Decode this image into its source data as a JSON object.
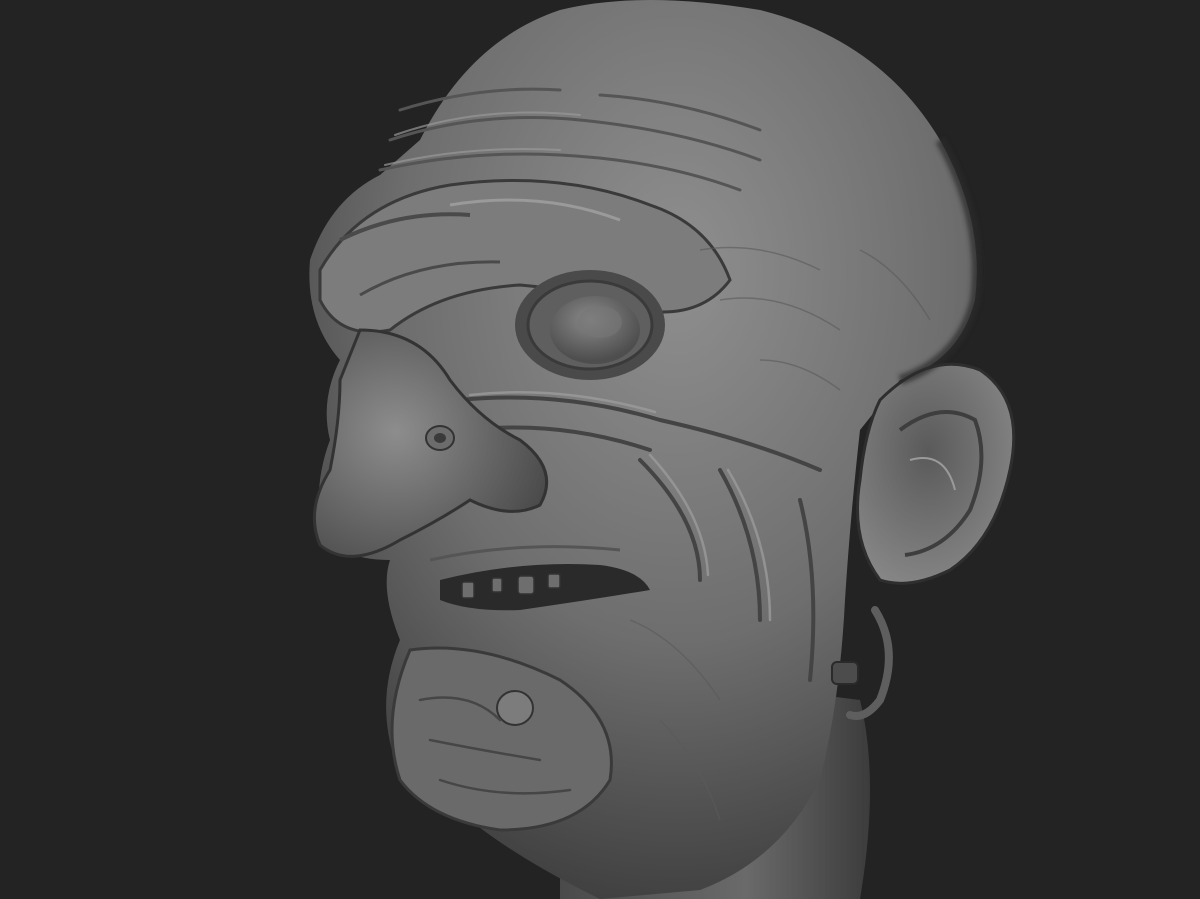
{
  "viewport": {
    "background_color": "#232323",
    "model": {
      "subject": "digital-sculpt-head",
      "material_color": "#7a7a7a",
      "shadow_color": "#2a2a2a",
      "highlight_color": "#a8a8a8"
    }
  }
}
